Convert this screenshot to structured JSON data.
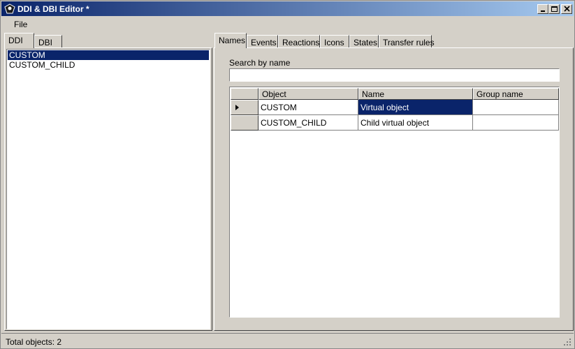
{
  "window": {
    "title": "DDI & DBI Editor *"
  },
  "menu": {
    "items": [
      {
        "label": "File"
      }
    ]
  },
  "left_tabs": [
    {
      "label": "DDI"
    },
    {
      "label": "DBI"
    }
  ],
  "object_list": [
    {
      "label": "CUSTOM"
    },
    {
      "label": "CUSTOM_CHILD"
    }
  ],
  "right_tabs": [
    {
      "label": "Names"
    },
    {
      "label": "Events"
    },
    {
      "label": "Reactions"
    },
    {
      "label": "Icons"
    },
    {
      "label": "States"
    },
    {
      "label": "Transfer rules"
    }
  ],
  "search": {
    "label": "Search by name",
    "value": ""
  },
  "grid": {
    "columns": [
      "Object",
      "Name",
      "Group name"
    ],
    "rows": [
      {
        "object": "CUSTOM",
        "name": "Virtual object",
        "group": ""
      },
      {
        "object": "CUSTOM_CHILD",
        "name": "Child virtual object",
        "group": ""
      }
    ]
  },
  "status": {
    "text": "Total objects: 2"
  },
  "colors": {
    "selection": "#0a246a",
    "face": "#d4d0c8"
  }
}
